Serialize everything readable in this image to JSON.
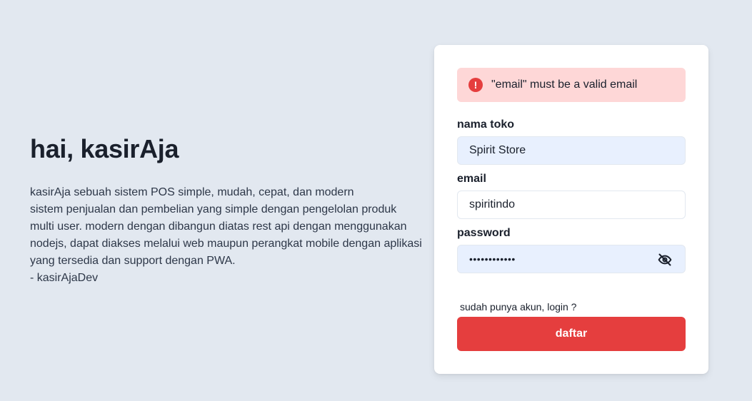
{
  "hero": {
    "title": "hai, kasirAja",
    "description_lines": [
      "kasirAja sebuah sistem POS simple, mudah, cepat, dan modern",
      "sistem penjualan dan pembelian yang simple dengan pengelolan produk",
      "multi user. modern dengan dibangun diatas rest api dengan menggunakan",
      "nodejs, dapat diakses melalui web maupun perangkat mobile dengan aplikasi",
      "yang tersedia dan support dengan PWA.",
      "- kasirAjaDev"
    ]
  },
  "alert": {
    "icon": "error-icon",
    "message": "\"email\" must be a valid email",
    "color": "#e53e3e",
    "background": "#fed7d7"
  },
  "form": {
    "store_label": "nama toko",
    "store_value": "Spirit Store",
    "email_label": "email",
    "email_value": "spiritindo",
    "password_label": "password",
    "password_value": "••••••••••••",
    "password_toggle_icon": "eye-off-icon",
    "login_link": "sudah punya akun, login ?",
    "submit_label": "daftar"
  },
  "colors": {
    "background": "#e2e8f0",
    "accent": "#e53e3e",
    "autofill": "#e8f0fe"
  }
}
